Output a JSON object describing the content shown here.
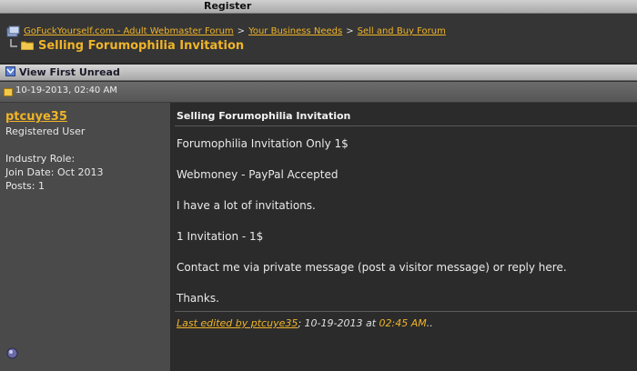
{
  "header": {
    "register_label": "Register"
  },
  "breadcrumb": {
    "items": [
      "GoFuckYourself.com - Adult Webmaster Forum",
      "Your Business Needs",
      "Sell and Buy Forum"
    ],
    "separator": ">"
  },
  "thread": {
    "title": "Selling Forumophilia Invitation"
  },
  "toolbar": {
    "view_first_unread": "View First Unread"
  },
  "post": {
    "date": "10-19-2013, 02:40 AM",
    "author": {
      "username": "ptcuye35",
      "role": "Registered User",
      "industry_role": "Industry Role:",
      "join_date": "Join Date: Oct 2013",
      "posts": "Posts: 1"
    },
    "title": "Selling Forumophilia Invitation",
    "body": [
      "Forumophilia Invitation Only 1$",
      "Webmoney - PayPal Accepted",
      "I have a lot of invitations.",
      "1 Invitation - 1$",
      "Contact me via private message (post a visitor message) or reply here.",
      "Thanks."
    ],
    "edit": {
      "link_text": "Last edited by ptcuye35",
      "middle": "; 10-19-2013 at ",
      "time": "02:45 AM",
      "end": ".."
    }
  },
  "colors": {
    "accent": "#f0b428",
    "background": "#2f2f2f",
    "user_panel": "#4a4a4a"
  }
}
